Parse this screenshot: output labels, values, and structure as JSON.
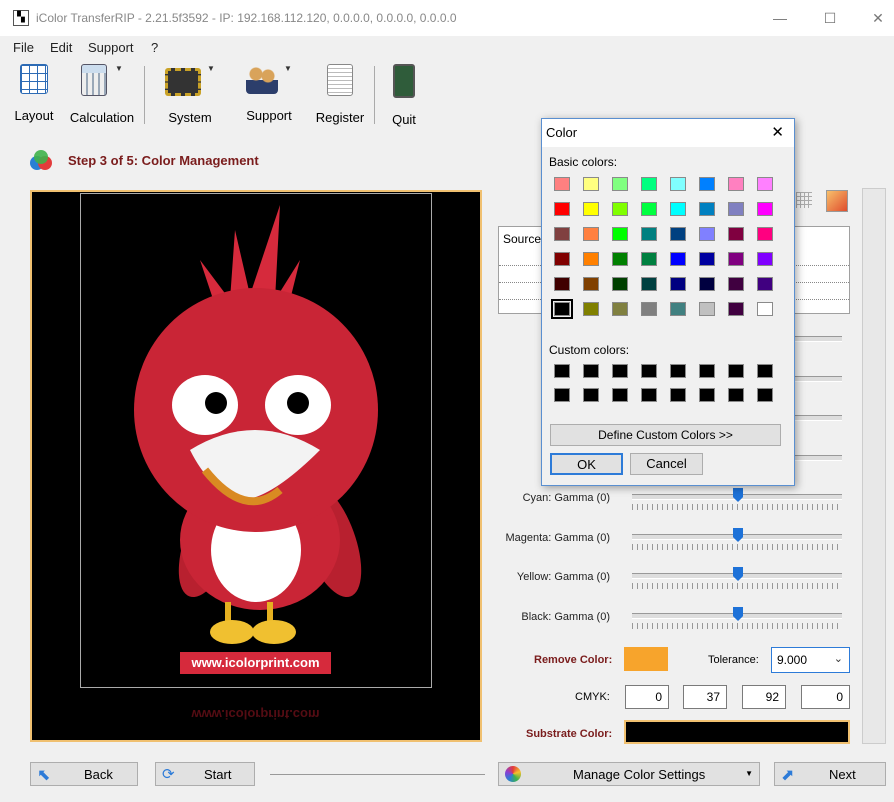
{
  "window": {
    "title": "iColor TransferRIP - 2.21.5f3592 - IP: 192.168.112.120, 0.0.0.0, 0.0.0.0, 0.0.0.0",
    "minimize": "—",
    "maximize": "☐",
    "close": "✕"
  },
  "menu": {
    "file": "File",
    "edit": "Edit",
    "support": "Support",
    "help": "?"
  },
  "toolbar": {
    "layout": "Layout",
    "calculation": "Calculation",
    "system": "System",
    "support": "Support",
    "register": "Register",
    "quit": "Quit"
  },
  "step": {
    "title": "Step 3 of 5: Color Management"
  },
  "preview": {
    "url_text": "www.icolorprint.com",
    "mirror_text": "www.icolorprint.com"
  },
  "source_panel": {
    "header": "Source"
  },
  "gamma": [
    {
      "label": "Cyan: Gamma  (0)",
      "value": 0
    },
    {
      "label": "Magenta: Gamma  (0)",
      "value": 0
    },
    {
      "label": "Yellow: Gamma  (0)",
      "value": 0
    },
    {
      "label": "Black: Gamma  (0)",
      "value": 0
    }
  ],
  "remove_color": {
    "label": "Remove Color:",
    "color": "#f7a42c",
    "tolerance_label": "Tolerance:",
    "tolerance_value": "9.000"
  },
  "cmyk": {
    "label": "CMYK:",
    "c": "0",
    "m": "37",
    "y": "92",
    "k": "0"
  },
  "substrate": {
    "label": "Substrate Color:",
    "color": "#000000"
  },
  "bottom": {
    "back": "Back",
    "start": "Start",
    "manage": "Manage Color Settings",
    "next": "Next"
  },
  "dialog": {
    "title": "Color",
    "close": "✕",
    "basic_label": "Basic colors:",
    "custom_label": "Custom colors:",
    "define_button": "Define Custom Colors >>",
    "ok": "OK",
    "cancel": "Cancel",
    "basic_colors": [
      [
        "#ff8080",
        "#ffff80",
        "#80ff80",
        "#00ff80",
        "#80ffff",
        "#0080ff",
        "#ff80c0",
        "#ff80ff"
      ],
      [
        "#ff0000",
        "#ffff00",
        "#80ff00",
        "#00ff40",
        "#00ffff",
        "#0080c0",
        "#8080c0",
        "#ff00ff"
      ],
      [
        "#804040",
        "#ff8040",
        "#00ff00",
        "#008080",
        "#004080",
        "#8080ff",
        "#800040",
        "#ff0080"
      ],
      [
        "#800000",
        "#ff8000",
        "#008000",
        "#008040",
        "#0000ff",
        "#0000a0",
        "#800080",
        "#8000ff"
      ],
      [
        "#400000",
        "#804000",
        "#004000",
        "#004040",
        "#000080",
        "#000040",
        "#400040",
        "#400080"
      ],
      [
        "#000000",
        "#808000",
        "#808040",
        "#808080",
        "#408080",
        "#c0c0c0",
        "#400040",
        "#ffffff"
      ]
    ],
    "custom_colors": [
      [
        "#000000",
        "#000000",
        "#000000",
        "#000000",
        "#000000",
        "#000000",
        "#000000",
        "#000000"
      ],
      [
        "#000000",
        "#000000",
        "#000000",
        "#000000",
        "#000000",
        "#000000",
        "#000000",
        "#000000"
      ]
    ],
    "selected": "#000000"
  }
}
